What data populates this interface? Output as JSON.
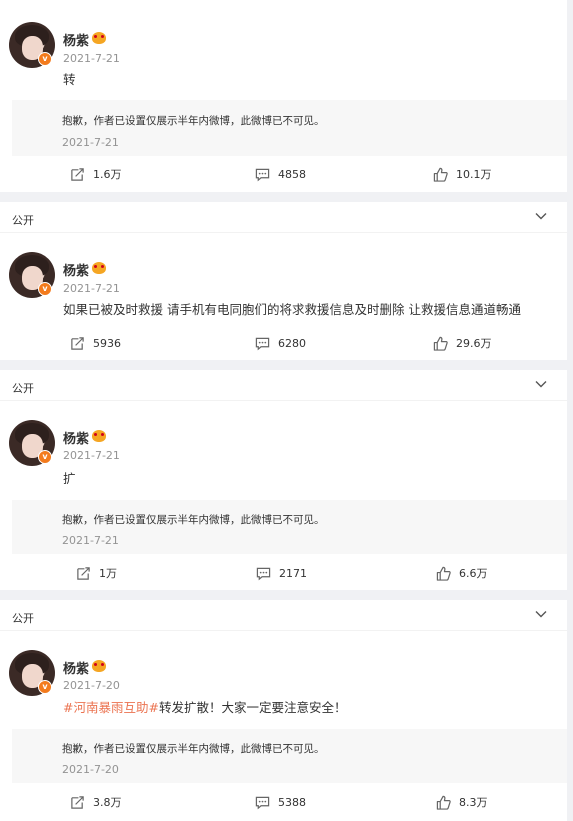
{
  "posts": [
    {
      "author": "杨紫",
      "date": "2021-7-21",
      "text": "转",
      "notice": {
        "text": "抱歉，作者已设置仅展示半年内微博，此微博已不可见。",
        "date": "2021-7-21"
      },
      "stats": {
        "repost": "1.6万",
        "comment": "4858",
        "like": "10.1万"
      }
    },
    {
      "visibility": "公开",
      "author": "杨紫",
      "date": "2021-7-21",
      "text": "如果已被及时救援 请手机有电同胞们的将求救援信息及时删除 让救援信息通道畅通",
      "stats": {
        "repost": "5936",
        "comment": "6280",
        "like": "29.6万"
      }
    },
    {
      "visibility": "公开",
      "author": "杨紫",
      "date": "2021-7-21",
      "text": "扩",
      "notice": {
        "text": "抱歉，作者已设置仅展示半年内微博，此微博已不可见。",
        "date": "2021-7-21"
      },
      "stats": {
        "repost": "1万",
        "comment": "2171",
        "like": "6.6万"
      }
    },
    {
      "visibility": "公开",
      "author": "杨紫",
      "date": "2021-7-20",
      "hashtag": "#河南暴雨互助#",
      "text": "转发扩散！大家一定要注意安全！",
      "notice": {
        "text": "抱歉，作者已设置仅展示半年内微博，此微博已不可见。",
        "date": "2021-7-20"
      },
      "stats": {
        "repost": "3.8万",
        "comment": "5388",
        "like": "8.3万"
      }
    }
  ],
  "icons": {
    "repost": "repost-icon",
    "comment": "comment-icon",
    "like": "like-icon",
    "verified": "verified-badge",
    "chevron": "chevron-down-icon"
  },
  "colors": {
    "accent": "#eb7350",
    "badge": "#f37b1d",
    "muted": "#939393",
    "background": "#f0f1f4",
    "notice_bg": "#f7f7f7"
  }
}
